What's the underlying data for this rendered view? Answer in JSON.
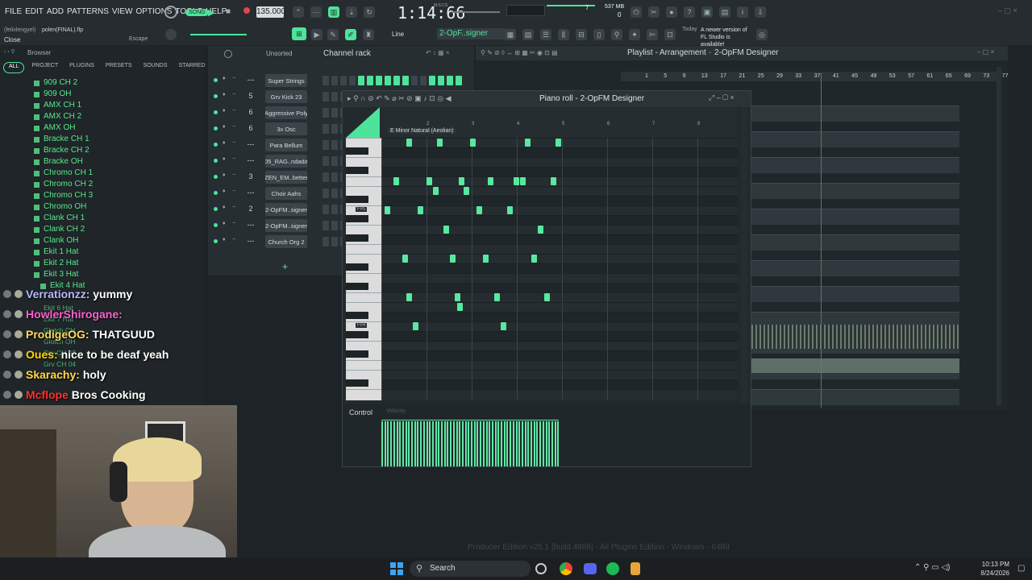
{
  "menu": [
    "FILE",
    "EDIT",
    "ADD",
    "PATTERNS",
    "VIEW",
    "OPTIONS",
    "TOOLS",
    "HELP"
  ],
  "song_mode_label": "SONG",
  "tempo": "135.000",
  "time_display": "1:14:66",
  "time_unit": "M:S:CS",
  "memory": "537 MB",
  "cpu_a": "7",
  "cpu_b": "0",
  "project_user": "(felixlengyel)",
  "project_file": "polen(FINAL).flp",
  "hint_close": "Close",
  "hint_escape": "Escape",
  "snap": "Line",
  "pattern": "2-OpF..signer",
  "news_today": "Today",
  "news_text": "A newer version of FL Studio is available!",
  "browser": {
    "title": "Browser",
    "tabs": [
      "ALL",
      "PROJECT",
      "PLUGINS",
      "PRESETS",
      "SOUNDS",
      "STARRED"
    ],
    "items": [
      "909 CH 2",
      "909 OH",
      "AMX CH 1",
      "AMX CH 2",
      "AMX OH",
      "Bracke CH 1",
      "Bracke CH 2",
      "Bracke OH",
      "Chromo CH 1",
      "Chromo CH 2",
      "Chromo CH 3",
      "Chromo OH",
      "Clank CH 1",
      "Clank CH 2",
      "Clank OH",
      "Ekit 1 Hat",
      "Ekit 2 Hat",
      "Ekit 3 Hat",
      "Ekit 4 Hat"
    ],
    "hidden_items": [
      "Ekit 6 Hat",
      "Ekit 7 Hat",
      "Glotch CH",
      "Glotch OH",
      "Grv CH 02",
      "Grv CH 04"
    ]
  },
  "channel_rack": {
    "title": "Channel rack",
    "filter": "Unsorted",
    "channels": [
      {
        "num": "---",
        "name": "Super Strings"
      },
      {
        "num": "5",
        "name": "Grv Kick 23"
      },
      {
        "num": "6",
        "name": "Aggressive Poly"
      },
      {
        "num": "6",
        "name": "3x Osc"
      },
      {
        "num": "---",
        "name": "Para Bellum"
      },
      {
        "num": "---",
        "name": "05_RAG..ndada"
      },
      {
        "num": "3",
        "name": "ZEN_EM..better"
      },
      {
        "num": "---",
        "name": "Choir Aahs"
      },
      {
        "num": "2",
        "name": "2-OpFM..signer"
      },
      {
        "num": "---",
        "name": "2-OpFM..signer"
      },
      {
        "num": "---",
        "name": "Church Org 2"
      }
    ],
    "add_label": "+"
  },
  "playlist": {
    "title": "Playlist - Arrangement",
    "pattern": "2-OpFM Designer",
    "bars": [
      "1",
      "5",
      "9",
      "13",
      "17",
      "21",
      "25",
      "29",
      "33",
      "37",
      "41",
      "45",
      "49",
      "53",
      "57",
      "61",
      "65",
      "69",
      "73",
      "77"
    ]
  },
  "piano_roll": {
    "title": "Piano roll - 2-OpFM Designer",
    "scale": "E Minor Natural (Aeolian)",
    "bar_numbers": [
      "2",
      "3",
      "4",
      "5",
      "6",
      "7",
      "8"
    ],
    "key_labels": [
      "F#5",
      "F#4"
    ],
    "control_label": "Control",
    "velocity_label": "Velocity",
    "notes": [
      {
        "x": 0.5,
        "row": 0
      },
      {
        "x": 1.2,
        "row": 0
      },
      {
        "x": 1.95,
        "row": 0
      },
      {
        "x": 3.2,
        "row": 0
      },
      {
        "x": 3.9,
        "row": 0
      },
      {
        "x": 0.2,
        "row": 4
      },
      {
        "x": 0.95,
        "row": 4
      },
      {
        "x": 1.7,
        "row": 4
      },
      {
        "x": 2.35,
        "row": 4
      },
      {
        "x": 2.95,
        "row": 4
      },
      {
        "x": 3.1,
        "row": 4
      },
      {
        "x": 3.8,
        "row": 4
      },
      {
        "x": 1.1,
        "row": 5
      },
      {
        "x": 1.8,
        "row": 5
      },
      {
        "x": 0.0,
        "row": 7
      },
      {
        "x": 0.75,
        "row": 7
      },
      {
        "x": 2.1,
        "row": 7
      },
      {
        "x": 2.8,
        "row": 7
      },
      {
        "x": 1.35,
        "row": 9
      },
      {
        "x": 3.5,
        "row": 9
      },
      {
        "x": 0.4,
        "row": 12
      },
      {
        "x": 1.5,
        "row": 12
      },
      {
        "x": 2.25,
        "row": 12
      },
      {
        "x": 3.35,
        "row": 12
      },
      {
        "x": 0.5,
        "row": 16
      },
      {
        "x": 1.6,
        "row": 16
      },
      {
        "x": 2.5,
        "row": 16
      },
      {
        "x": 3.65,
        "row": 16
      },
      {
        "x": 1.65,
        "row": 17
      },
      {
        "x": 0.65,
        "row": 19
      },
      {
        "x": 2.65,
        "row": 19
      }
    ]
  },
  "chat": [
    {
      "user": "Verrationzz:",
      "msg": "yummy",
      "color": "#b8b8ff"
    },
    {
      "user": "HowlerShirogane:",
      "msg": "",
      "color": "#ff5fd2"
    },
    {
      "user": "ProdigeOG:",
      "msg": "THATGUUD",
      "color": "#ffd85a"
    },
    {
      "user": "Oues:",
      "msg": "nice to be deaf yeah",
      "color": "#ffd400"
    },
    {
      "user": "Skarachy:",
      "msg": "holy",
      "color": "#ffd84a"
    },
    {
      "user": "Mcflope",
      "msg": "Bros Cooking",
      "color": "#ff3030"
    }
  ],
  "status_bar": "Producer Edition v25.1 [build 4868] - All Plugins Edition - Windows - 64Bit",
  "taskbar": {
    "search": "Search",
    "time": "10:13 PM",
    "date": "8/24/2026"
  },
  "colors": {
    "accent": "#4ee39a",
    "bg": "#1d2327"
  }
}
